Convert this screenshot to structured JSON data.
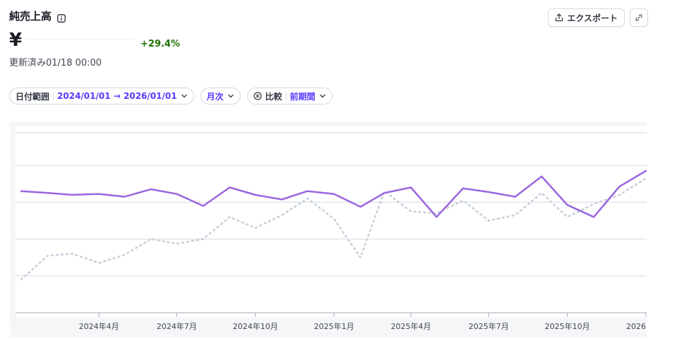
{
  "header": {
    "title": "純売上高",
    "currency_symbol": "¥",
    "change": "+29.4%",
    "updated": "更新済み01/18 00:00"
  },
  "actions": {
    "export_label": "エクスポート"
  },
  "filters": {
    "date_range_label": "日付範囲",
    "date_range_value": "2024/01/01 → 2026/01/01",
    "interval_value": "月次",
    "compare_label": "比較",
    "compare_value": "前期間"
  },
  "colors": {
    "current": "#9966e0",
    "previous": "#c5cfda",
    "positive": "#217005",
    "accent": "#533afd"
  },
  "chart_data": {
    "type": "line",
    "x": [
      "2024-01-01",
      "2024-02-01",
      "2024-03-01",
      "2024-04-01",
      "2024-05-01",
      "2024-06-01",
      "2024-07-01",
      "2024-08-01",
      "2024-09-01",
      "2024-10-01",
      "2024-11-01",
      "2024-12-01",
      "2025-01-01",
      "2025-02-01",
      "2025-03-01",
      "2025-04-01",
      "2025-05-01",
      "2025-06-01",
      "2025-07-01",
      "2025-08-01",
      "2025-09-01",
      "2025-10-01",
      "2025-11-01",
      "2025-12-01",
      "2026-01-01"
    ],
    "tick_labels": [
      "2024年4月",
      "2024年7月",
      "2024年10月",
      "2025年1月",
      "2025年4月",
      "2025年7月",
      "2025年10月",
      "2026"
    ],
    "tick_dates": [
      "2024-04-01",
      "2024-07-01",
      "2024-10-01",
      "2025-01-01",
      "2025-04-01",
      "2025-07-01",
      "2025-10-01",
      "2026-01-01"
    ],
    "ylim": [
      0,
      100
    ],
    "y_gridlines": [
      20,
      40,
      60,
      80
    ],
    "series": [
      {
        "style": "solid",
        "values": [
          66,
          65,
          64,
          64.5,
          63,
          67,
          64.5,
          58,
          68,
          64,
          61.5,
          66,
          64.5,
          57.5,
          65,
          68,
          52,
          67.5,
          65.5,
          63,
          74,
          58.5,
          52,
          68.5,
          77
        ]
      },
      {
        "style": "dotted",
        "values": [
          18,
          31,
          32,
          27,
          31.5,
          40,
          37.5,
          40,
          52,
          46,
          53,
          62,
          51,
          30,
          66,
          55,
          54,
          61,
          50,
          53,
          65,
          52,
          59,
          64,
          73
        ]
      }
    ],
    "grid": true,
    "legend": "none"
  }
}
